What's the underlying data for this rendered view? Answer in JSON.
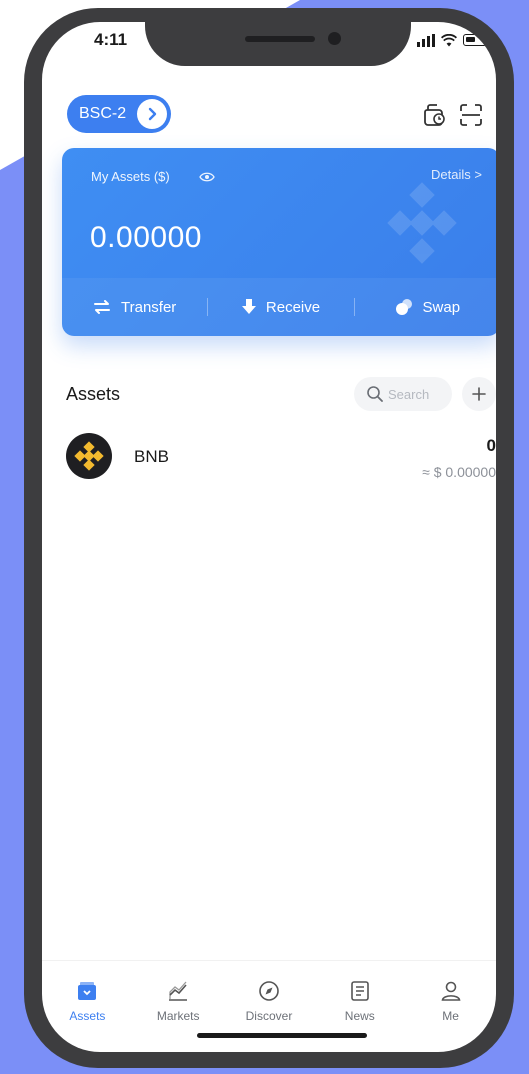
{
  "status_bar": {
    "time": "4:11"
  },
  "header": {
    "network_label": "BSC-2"
  },
  "assets_card": {
    "label": "My Assets  ($)",
    "details_label": "Details  >",
    "balance": "0.00000",
    "actions": [
      {
        "label": "Transfer",
        "icon": "transfer-icon"
      },
      {
        "label": "Receive",
        "icon": "receive-icon"
      },
      {
        "label": "Swap",
        "icon": "swap-icon"
      }
    ]
  },
  "assets_section": {
    "title": "Assets",
    "search_placeholder": "Search",
    "tokens": [
      {
        "name": "BNB",
        "amount": "0",
        "fiat_value": "≈ $ 0.00000"
      }
    ]
  },
  "tab_bar": {
    "tabs": [
      {
        "label": "Assets",
        "icon": "wallet-icon",
        "active": true
      },
      {
        "label": "Markets",
        "icon": "chart-icon",
        "active": false
      },
      {
        "label": "Discover",
        "icon": "compass-icon",
        "active": false
      },
      {
        "label": "News",
        "icon": "news-icon",
        "active": false
      },
      {
        "label": "Me",
        "icon": "person-icon",
        "active": false
      }
    ]
  },
  "colors": {
    "accent": "#3d7ff0",
    "frame": "#3d3d3f",
    "background_shape": "#7b8ff7",
    "bnb_yellow": "#f3ba2f"
  }
}
